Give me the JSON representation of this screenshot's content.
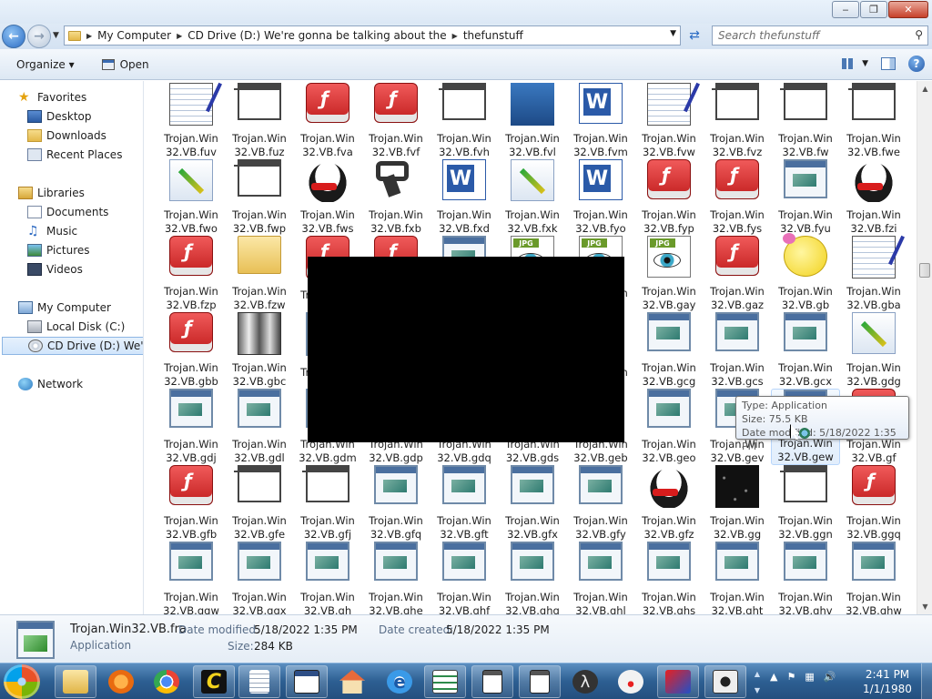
{
  "window": {
    "min": "‒",
    "max": "❐",
    "close": "✕"
  },
  "address": {
    "crumbs": [
      "My Computer",
      "CD Drive (D:) We're gonna be talking about the",
      "thefunstuff"
    ],
    "search_placeholder": "Search thefunstuff"
  },
  "toolbar": {
    "organize": "Organize ▾",
    "open": "Open"
  },
  "nav": {
    "favorites": "Favorites",
    "desktop": "Desktop",
    "downloads": "Downloads",
    "recent": "Recent Places",
    "libraries": "Libraries",
    "documents": "Documents",
    "music": "Music",
    "pictures": "Pictures",
    "videos": "Videos",
    "computer": "My Computer",
    "local": "Local Disk (C:)",
    "cd": "CD Drive (D:) We're g",
    "network": "Network"
  },
  "prefix": "Trojan.Win",
  "files": [
    {
      "l": "32.VB.fuv",
      "i": "note"
    },
    {
      "l": "32.VB.fuz",
      "i": "bat"
    },
    {
      "l": "32.VB.fva",
      "i": "flash"
    },
    {
      "l": "32.VB.fvf",
      "i": "flash"
    },
    {
      "l": "32.VB.fvh",
      "i": "bat"
    },
    {
      "l": "32.VB.fvl",
      "i": "three"
    },
    {
      "l": "32.VB.fvm",
      "i": "word"
    },
    {
      "l": "32.VB.fvw",
      "i": "note"
    },
    {
      "l": "32.VB.fvz",
      "i": "bat"
    },
    {
      "l": "32.VB.fw",
      "i": "bat"
    },
    {
      "l": "32.VB.fwe",
      "i": "bat"
    },
    {
      "l": "32.VB.fwo",
      "i": "brush"
    },
    {
      "l": "32.VB.fwp",
      "i": "bat"
    },
    {
      "l": "32.VB.fws",
      "i": "tux"
    },
    {
      "l": "32.VB.fxb",
      "i": "pipe"
    },
    {
      "l": "32.VB.fxd",
      "i": "word"
    },
    {
      "l": "32.VB.fxk",
      "i": "brush"
    },
    {
      "l": "32.VB.fyo",
      "i": "word"
    },
    {
      "l": "32.VB.fyp",
      "i": "flash"
    },
    {
      "l": "32.VB.fys",
      "i": "flash"
    },
    {
      "l": "32.VB.fyu",
      "i": "app"
    },
    {
      "l": "32.VB.fzi",
      "i": "tux"
    },
    {
      "l": "32.VB.fzp",
      "i": "flash"
    },
    {
      "l": "32.VB.fzw",
      "i": "folder"
    },
    {
      "l": "",
      "i": "flash"
    },
    {
      "l": "",
      "i": "flash"
    },
    {
      "l": "",
      "i": "app"
    },
    {
      "l": "",
      "i": "jpg"
    },
    {
      "l": "",
      "i": "jpg"
    },
    {
      "l": "32.VB.gay",
      "i": "jpg"
    },
    {
      "l": "32.VB.gaz",
      "i": "flash"
    },
    {
      "l": "32.VB.gb",
      "i": "duck"
    },
    {
      "l": "32.VB.gba",
      "i": "note"
    },
    {
      "l": "32.VB.gbb",
      "i": "flash"
    },
    {
      "l": "32.VB.gbc",
      "i": "tool"
    },
    {
      "l": "",
      "i": "app"
    },
    {
      "l": "",
      "i": "app"
    },
    {
      "l": "",
      "i": "app"
    },
    {
      "l": "",
      "i": "app"
    },
    {
      "l": "",
      "i": "app"
    },
    {
      "l": "32.VB.gcg",
      "i": "app"
    },
    {
      "l": "32.VB.gcs",
      "i": "app"
    },
    {
      "l": "32.VB.gcx",
      "i": "app"
    },
    {
      "l": "32.VB.gdg",
      "i": "brush"
    },
    {
      "l": "32.VB.gdj",
      "i": "app"
    },
    {
      "l": "32.VB.gdl",
      "i": "app"
    },
    {
      "l": "32.VB.gdm",
      "i": "app"
    },
    {
      "l": "32.VB.gdp",
      "i": "app"
    },
    {
      "l": "32.VB.gdq",
      "i": "app"
    },
    {
      "l": "32.VB.gds",
      "i": "app"
    },
    {
      "l": "32.VB.geb",
      "i": "app"
    },
    {
      "l": "32.VB.geo",
      "i": "app"
    },
    {
      "l": "32.VB.gev",
      "i": "app"
    },
    {
      "l": "32.VB.gew",
      "i": "app"
    },
    {
      "l": "32.VB.gf",
      "i": "flash"
    },
    {
      "l": "32.VB.gfb",
      "i": "flash"
    },
    {
      "l": "32.VB.gfe",
      "i": "bat"
    },
    {
      "l": "32.VB.gfj",
      "i": "bat"
    },
    {
      "l": "32.VB.gfq",
      "i": "app"
    },
    {
      "l": "32.VB.gft",
      "i": "app"
    },
    {
      "l": "32.VB.gfx",
      "i": "app"
    },
    {
      "l": "32.VB.gfy",
      "i": "app"
    },
    {
      "l": "32.VB.gfz",
      "i": "tux"
    },
    {
      "l": "32.VB.gg",
      "i": "dark"
    },
    {
      "l": "32.VB.ggn",
      "i": "bat"
    },
    {
      "l": "32.VB.ggq",
      "i": "flash"
    },
    {
      "l": "32.VB.ggw",
      "i": "app"
    },
    {
      "l": "32.VB.ggx",
      "i": "app"
    },
    {
      "l": "32.VB.gh",
      "i": "app"
    },
    {
      "l": "32.VB.ghe",
      "i": "app"
    },
    {
      "l": "32.VB.ghf",
      "i": "app"
    },
    {
      "l": "32.VB.ghg",
      "i": "app"
    },
    {
      "l": "32.VB.ghl",
      "i": "app"
    },
    {
      "l": "32.VB.ghs",
      "i": "app"
    },
    {
      "l": "32.VB.ght",
      "i": "app"
    },
    {
      "l": "32.VB.ghv",
      "i": "app"
    },
    {
      "l": "32.VB.ghw",
      "i": "app"
    }
  ],
  "tooltip": {
    "type": "Type: Application",
    "size": "Size: 75.5 KB",
    "date": "Date modified: 5/18/2022 1:35 PM"
  },
  "details": {
    "name": "Trojan.Win32.VB.fra",
    "kind": "Application",
    "modified_label": "Date modified:",
    "modified": "5/18/2022 1:35 PM",
    "created_label": "Date created:",
    "created": "5/18/2022 1:35 PM",
    "size_label": "Size:",
    "size": "284 KB"
  },
  "clock": {
    "time": "2:41 PM",
    "date": "1/1/1980"
  }
}
